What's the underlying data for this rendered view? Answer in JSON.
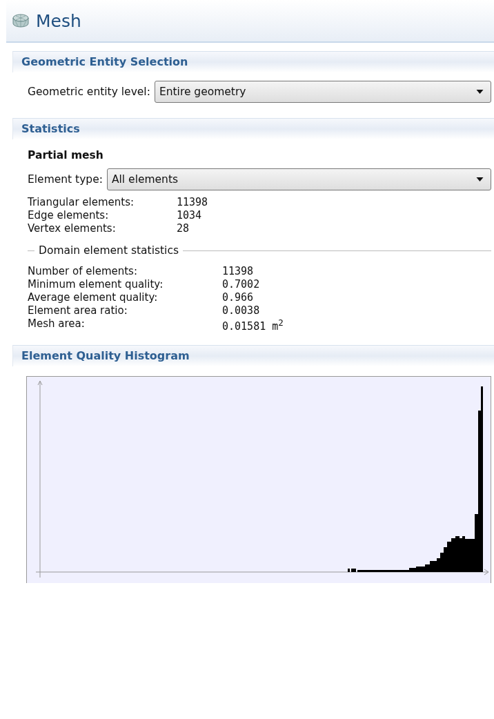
{
  "title": "Mesh",
  "sections": [
    {
      "kind": "selection",
      "title": "Geometric Entity Selection",
      "field": {
        "label": "Geometric entity level:",
        "value": "Entire geometry"
      }
    },
    {
      "kind": "statistics",
      "title": "Statistics",
      "subtitle": "Partial mesh",
      "field": {
        "label": "Element type:",
        "value": "All elements"
      },
      "counts": [
        {
          "label": "Triangular elements:",
          "value": "11398"
        },
        {
          "label": "Edge elements:",
          "value": "1034"
        },
        {
          "label": "Vertex elements:",
          "value": "28"
        }
      ],
      "group": {
        "title": "Domain element statistics",
        "rows": [
          {
            "label": "Number of elements:",
            "value": "11398"
          },
          {
            "label": "Minimum element quality:",
            "value": "0.7002"
          },
          {
            "label": "Average element quality:",
            "value": "0.966"
          },
          {
            "label": "Element area ratio:",
            "value": "0.0038"
          },
          {
            "label": "Mesh area:",
            "value": "0.01581 m$^{2}$"
          }
        ]
      }
    },
    {
      "kind": "histogram",
      "title": "Element Quality Histogram"
    }
  ]
}
